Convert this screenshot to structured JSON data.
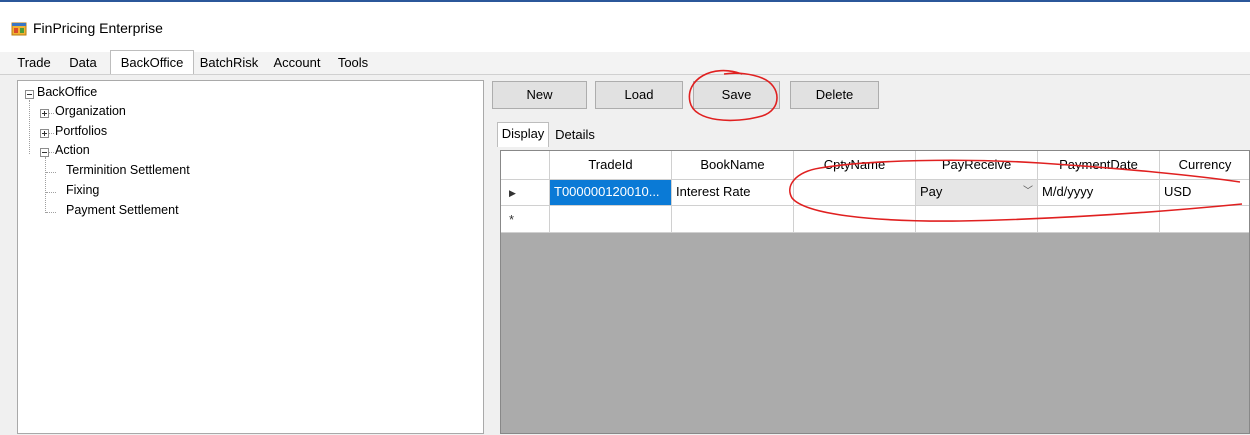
{
  "window": {
    "title": "FinPricing Enterprise",
    "icon": "app-window-icon"
  },
  "main_tabs": [
    {
      "label": "Trade",
      "active": false
    },
    {
      "label": "Data",
      "active": false
    },
    {
      "label": "BackOffice",
      "active": true
    },
    {
      "label": "BatchRisk",
      "active": false
    },
    {
      "label": "Account",
      "active": false
    },
    {
      "label": "Tools",
      "active": false
    }
  ],
  "tree": {
    "root": "BackOffice",
    "organization": "Organization",
    "portfolios": "Portfolios",
    "action": "Action",
    "action_children": [
      "Terminition Settlement",
      "Fixing",
      "Payment Settlement"
    ]
  },
  "toolbar": {
    "new_label": "New",
    "load_label": "Load",
    "save_label": "Save",
    "delete_label": "Delete"
  },
  "sub_tabs": [
    {
      "label": "Display",
      "active": true
    },
    {
      "label": "Details",
      "active": false
    }
  ],
  "grid": {
    "columns": [
      "TradeId",
      "BookName",
      "CptyName",
      "PayReceive",
      "PaymentDate",
      "Currency"
    ],
    "rows": [
      {
        "indicator": "▶",
        "TradeId": "T000000120010...",
        "BookName": "Interest Rate",
        "CptyName": "",
        "PayReceive": "Pay",
        "PaymentDate": "M/d/yyyy",
        "Currency": "USD"
      }
    ],
    "new_row_indicator": "*"
  },
  "colors": {
    "selection": "#0a7ad6",
    "annotation": "#e02020",
    "grid_background": "#ababab"
  }
}
